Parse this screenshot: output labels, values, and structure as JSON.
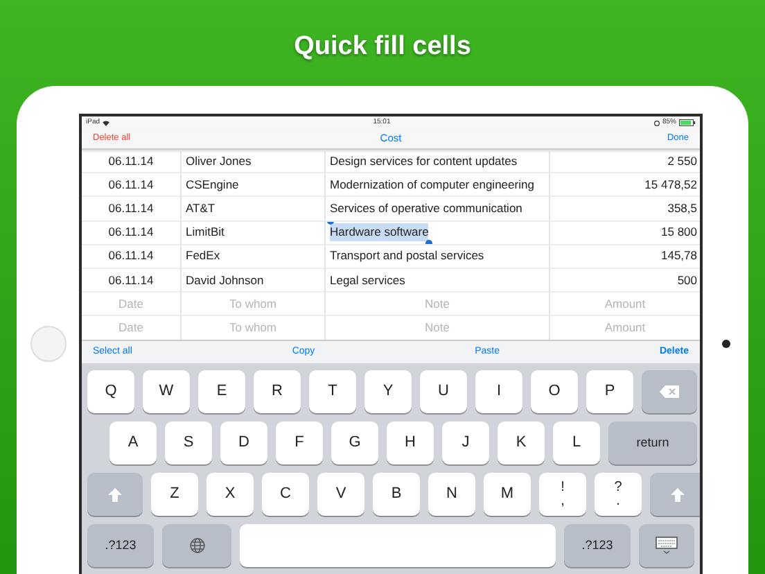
{
  "headline": "Quick fill cells",
  "status_bar": {
    "device": "iPad",
    "time": "15:01",
    "battery": "85%"
  },
  "nav": {
    "left": "Delete all",
    "title": "Cost",
    "right": "Done"
  },
  "rows": [
    {
      "date": "06.11.14",
      "to_whom": "Oliver Jones",
      "note": "Design services for content updates",
      "amount": "2 550",
      "note_selected": false
    },
    {
      "date": "06.11.14",
      "to_whom": "CSEngine",
      "note": "Modernization of computer engineering",
      "amount": "15 478,52",
      "note_selected": false
    },
    {
      "date": "06.11.14",
      "to_whom": "AT&T",
      "note": "Services of operative communication",
      "amount": "358,5",
      "note_selected": false
    },
    {
      "date": "06.11.14",
      "to_whom": "LimitBit",
      "note": "Hardware software",
      "amount": "15 800",
      "note_selected": true
    },
    {
      "date": "06.11.14",
      "to_whom": "FedEx",
      "note": "Transport and postal services",
      "amount": "145,78",
      "note_selected": false
    },
    {
      "date": "06.11.14",
      "to_whom": "David Johnson",
      "note": "Legal services",
      "amount": "500",
      "note_selected": false
    }
  ],
  "empty_rows": [
    {
      "date": "Date",
      "to_whom": "To whom",
      "note": "Note",
      "amount": "Amount"
    },
    {
      "date": "Date",
      "to_whom": "To whom",
      "note": "Note",
      "amount": "Amount"
    }
  ],
  "edit_bar": [
    "Select all",
    "Copy",
    "Paste",
    "Delete"
  ],
  "keyboard": [
    {
      "indent": false,
      "keys": [
        {
          "kind": "char",
          "label": "Q"
        },
        {
          "kind": "char",
          "label": "W"
        },
        {
          "kind": "char",
          "label": "E"
        },
        {
          "kind": "char",
          "label": "R"
        },
        {
          "kind": "char",
          "label": "T"
        },
        {
          "kind": "char",
          "label": "Y"
        },
        {
          "kind": "char",
          "label": "U"
        },
        {
          "kind": "char",
          "label": "I"
        },
        {
          "kind": "char",
          "label": "O"
        },
        {
          "kind": "char",
          "label": "P"
        },
        {
          "kind": "backspace"
        }
      ]
    },
    {
      "indent": true,
      "keys": [
        {
          "kind": "char",
          "label": "A"
        },
        {
          "kind": "char",
          "label": "S"
        },
        {
          "kind": "char",
          "label": "D"
        },
        {
          "kind": "char",
          "label": "F"
        },
        {
          "kind": "char",
          "label": "G"
        },
        {
          "kind": "char",
          "label": "H"
        },
        {
          "kind": "char",
          "label": "J"
        },
        {
          "kind": "char",
          "label": "K"
        },
        {
          "kind": "char",
          "label": "L"
        },
        {
          "kind": "return",
          "label": "return"
        }
      ]
    },
    {
      "indent": false,
      "keys": [
        {
          "kind": "shift"
        },
        {
          "kind": "char",
          "label": "Z"
        },
        {
          "kind": "char",
          "label": "X"
        },
        {
          "kind": "char",
          "label": "C"
        },
        {
          "kind": "char",
          "label": "V"
        },
        {
          "kind": "char",
          "label": "B"
        },
        {
          "kind": "char",
          "label": "N"
        },
        {
          "kind": "char",
          "label": "M"
        },
        {
          "kind": "pair",
          "top": "!",
          "bottom": ","
        },
        {
          "kind": "pair",
          "top": "?",
          "bottom": "."
        },
        {
          "kind": "shift"
        }
      ]
    },
    {
      "indent": false,
      "keys": [
        {
          "kind": "mode",
          "label": ".?123"
        },
        {
          "kind": "globe"
        },
        {
          "kind": "space"
        },
        {
          "kind": "mode",
          "label": ".?123"
        },
        {
          "kind": "hide"
        }
      ]
    }
  ]
}
